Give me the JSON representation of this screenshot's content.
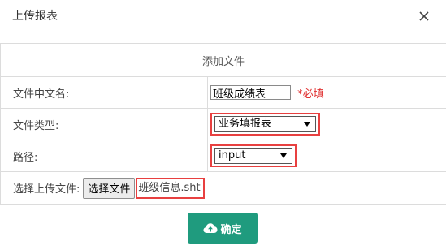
{
  "dialog": {
    "title": "上传报表"
  },
  "form": {
    "header": "添加文件",
    "chinese_name": {
      "label": "文件中文名:",
      "value": "班级成绩表",
      "required_text": "*必填"
    },
    "file_type": {
      "label": "文件类型:",
      "selected": "业务填报表"
    },
    "path": {
      "label": "路径:",
      "selected": "input"
    },
    "upload": {
      "label": "选择上传文件:",
      "button_label": "选择文件",
      "file_name": "班级信息.sht"
    }
  },
  "actions": {
    "confirm_label": "确定"
  },
  "colors": {
    "accent": "#1f9b7e",
    "highlight": "#e84040",
    "required": "#e03030"
  },
  "icons": {
    "close": "close-icon",
    "upload": "cloud-upload-icon",
    "dropdown": "chevron-down-icon"
  }
}
